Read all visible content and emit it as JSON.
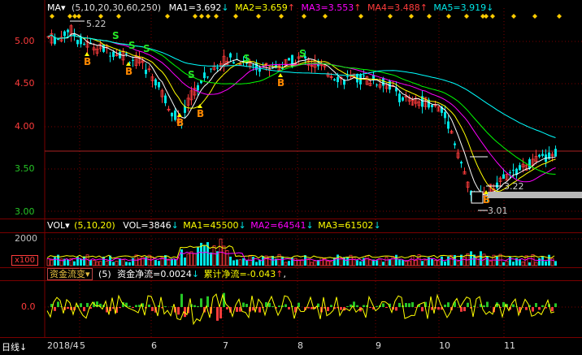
{
  "main": {
    "indicator_name": "MA",
    "params": "(5,10,20,30,60,250)",
    "ma1": "MA1=3.692",
    "ma2": "MA2=3.659",
    "ma3": "MA3=3.553",
    "ma4": "MA4=3.488",
    "ma5": "MA5=3.919",
    "y_ticks": [
      "5.00",
      "4.50",
      "4.00",
      "3.50",
      "3.00"
    ],
    "high_label": "5.22",
    "low_label": "3.01",
    "mid_label": "3.22",
    "b_label": "B",
    "s_label": "S"
  },
  "volume": {
    "indicator_name": "VOL",
    "params": "(5,10,20)",
    "vol": "VOL=3846",
    "ma1": "MA1=45500",
    "ma2": "MA2=64541",
    "ma3": "MA3=61502",
    "y_tick": "2000",
    "unit": "x100"
  },
  "flow": {
    "indicator_name": "资金流变",
    "params": "(5)",
    "net": "资金净流=0.0024",
    "cum": "累计净流=-0.043",
    "y_tick": "0.0"
  },
  "timeline": {
    "period": "日线",
    "labels": [
      "2018/4",
      "5",
      "6",
      "7",
      "8",
      "9",
      "10",
      "11"
    ]
  },
  "colors": {
    "ma1": "#ffffff",
    "ma2": "#ffff00",
    "ma3": "#ff00ff",
    "ma4": "#00ff00",
    "ma5": "#00ffff",
    "up": "#ff3c3c",
    "down": "#00e5e5",
    "grid": "#7a0000"
  }
}
